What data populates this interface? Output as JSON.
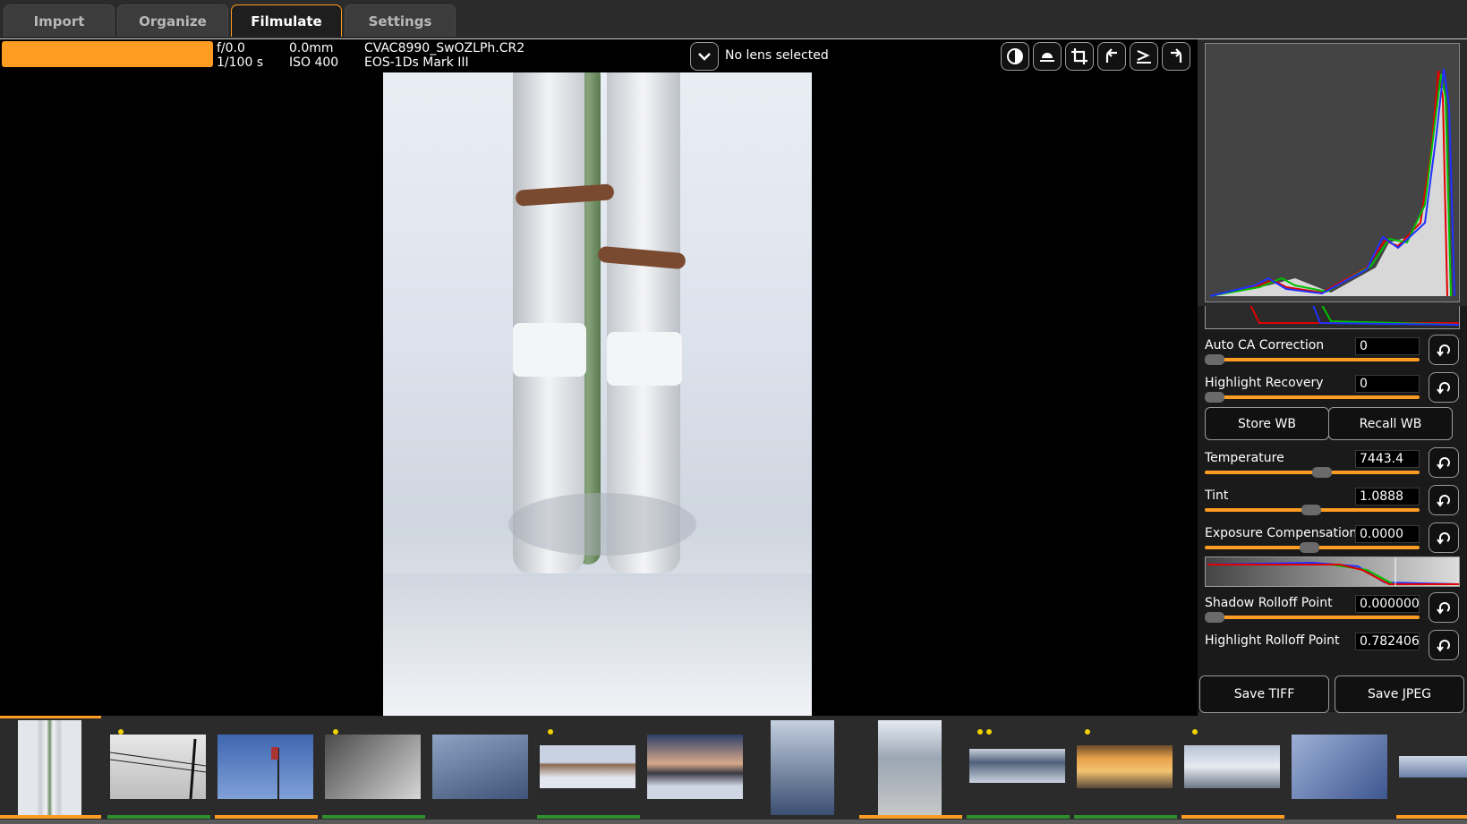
{
  "tabs": [
    {
      "label": "Import",
      "active": false
    },
    {
      "label": "Organize",
      "active": false
    },
    {
      "label": "Filmulate",
      "active": true
    },
    {
      "label": "Settings",
      "active": false
    }
  ],
  "exif": {
    "aperture": "f/0.0",
    "shutter": "1/100 s",
    "focal_length": "0.0mm",
    "iso": "ISO 400",
    "filename": "CVAC8990_SwOZLPh.CR2",
    "camera": "EOS-1Ds Mark III"
  },
  "lens": {
    "selected": "No lens selected"
  },
  "toolbar_icons": [
    "contrast-icon",
    "leveling-icon",
    "crop-icon",
    "rotate-left-icon",
    "flip-icon",
    "rotate-right-icon"
  ],
  "controls": {
    "auto_ca": {
      "label": "Auto CA Correction",
      "value": "0"
    },
    "highlight_recovery": {
      "label": "Highlight Recovery",
      "value": "0"
    },
    "store_wb": "Store WB",
    "recall_wb": "Recall WB",
    "temperature": {
      "label": "Temperature",
      "value": "7443.4"
    },
    "tint": {
      "label": "Tint",
      "value": "1.0888"
    },
    "exposure": {
      "label": "Exposure Compensation",
      "value": "0.0000"
    },
    "shadow_rolloff": {
      "label": "Shadow Rolloff Point",
      "value": "0.000000"
    },
    "highlight_rolloff": {
      "label": "Highlight Rolloff Point",
      "value": "0.782406"
    }
  },
  "save": {
    "tiff": "Save TIFF",
    "jpeg": "Save JPEG"
  },
  "colors": {
    "accent": "#ff9d22",
    "rated": "#2f8f2f",
    "selected": "#ff9d22"
  },
  "filmstrip": [
    {
      "name": "thumb-pipes-snow",
      "rating_dots": 0,
      "bar": "orange",
      "current": true
    },
    {
      "name": "thumb-power-lines",
      "rating_dots": 1,
      "bar": "green"
    },
    {
      "name": "thumb-flag-sky",
      "rating_dots": 0,
      "bar": "orange"
    },
    {
      "name": "thumb-car-snow",
      "rating_dots": 1,
      "bar": "green"
    },
    {
      "name": "thumb-snow-road",
      "rating_dots": 0,
      "bar": "none"
    },
    {
      "name": "thumb-houses-snow",
      "rating_dots": 1,
      "bar": "green"
    },
    {
      "name": "thumb-houses-dusk",
      "rating_dots": 0,
      "bar": "none"
    },
    {
      "name": "thumb-icy-puddle",
      "rating_dots": 0,
      "bar": "none"
    },
    {
      "name": "thumb-asphalt-snow",
      "rating_dots": 0,
      "bar": "orange"
    },
    {
      "name": "thumb-frozen-pond",
      "rating_dots": 2,
      "bar": "green"
    },
    {
      "name": "thumb-school-bus",
      "rating_dots": 1,
      "bar": "green"
    },
    {
      "name": "thumb-parking-lot",
      "rating_dots": 1,
      "bar": "orange"
    },
    {
      "name": "thumb-ice-closeup",
      "rating_dots": 0,
      "bar": "none"
    },
    {
      "name": "thumb-partial",
      "rating_dots": 0,
      "bar": "orange"
    }
  ]
}
